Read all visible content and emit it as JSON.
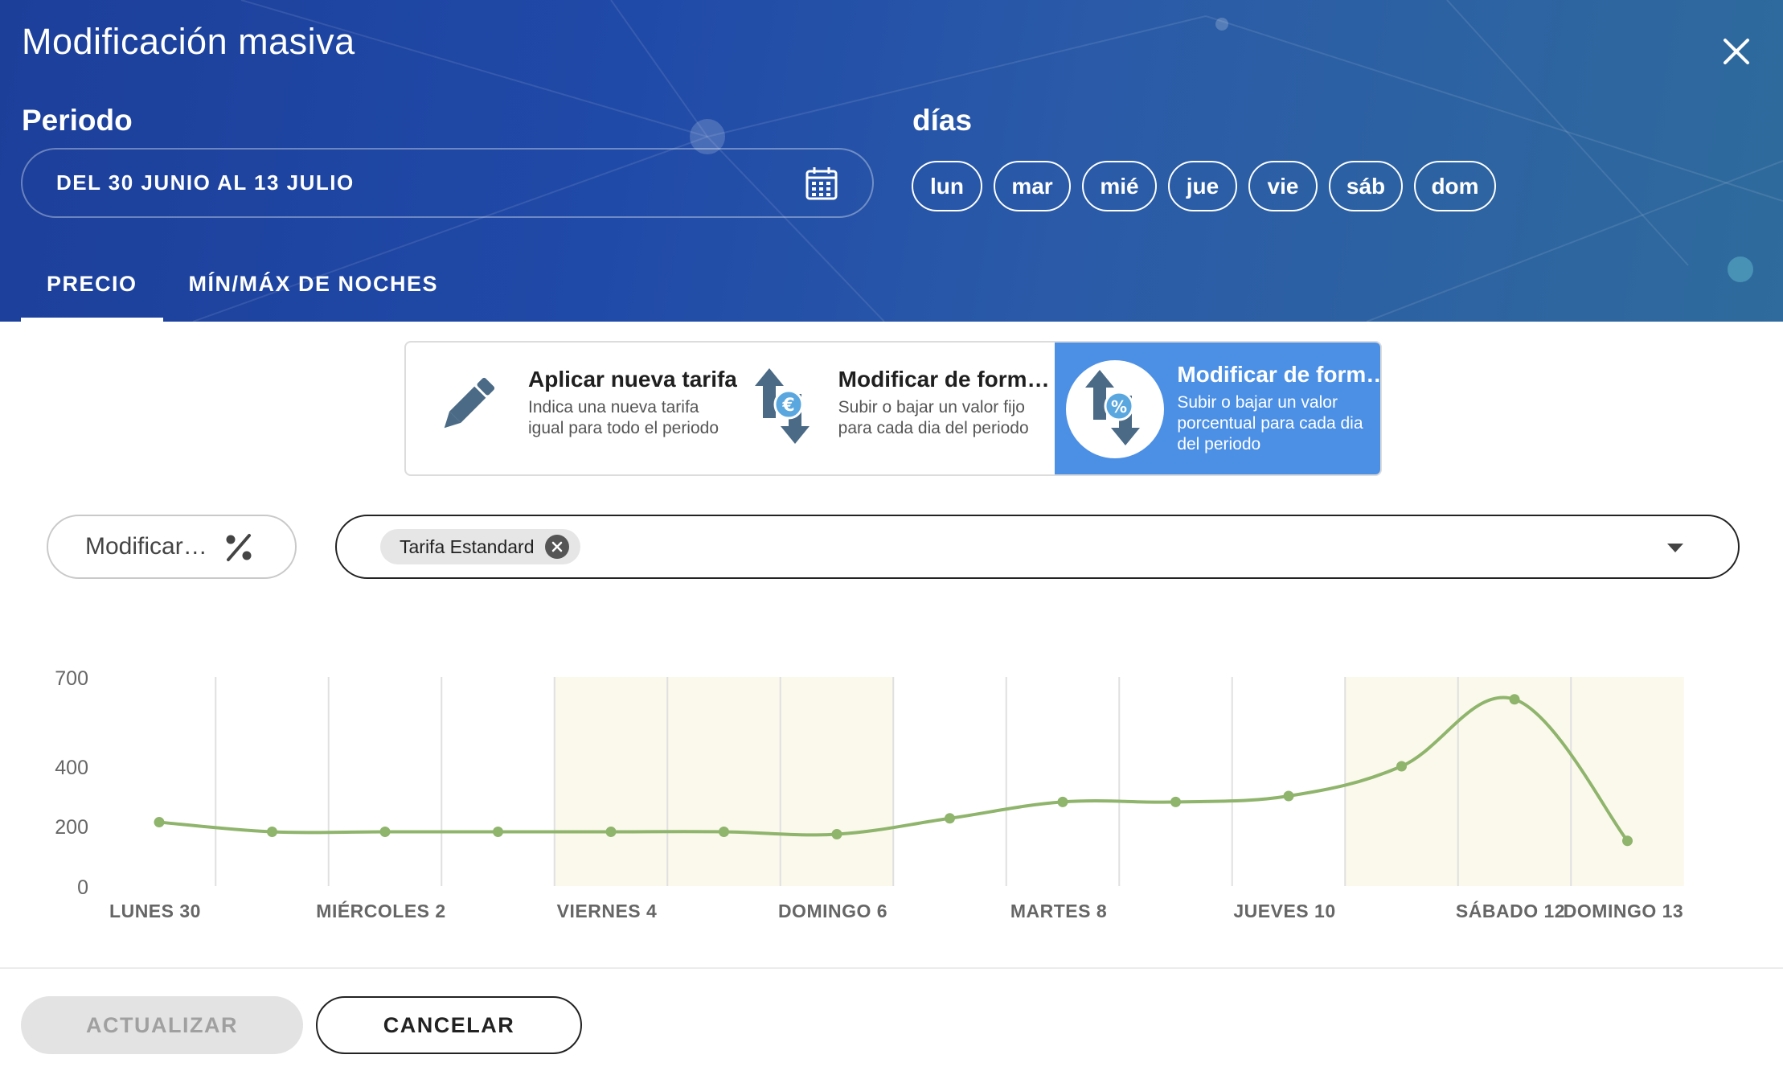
{
  "dialog": {
    "title": "Modificación masiva"
  },
  "period": {
    "label": "Periodo",
    "value": "DEL 30 JUNIO AL 13 JULIO"
  },
  "days": {
    "label": "días",
    "items": [
      "lun",
      "mar",
      "mié",
      "jue",
      "vie",
      "sáb",
      "dom"
    ]
  },
  "tabs": [
    {
      "label": "PRECIO",
      "active": true
    },
    {
      "label": "MÍN/MÁX DE NOCHES",
      "active": false
    }
  ],
  "modes": [
    {
      "title": "Aplicar nueva tarifa",
      "desc_lines": [
        "Indica una nueva tarifa",
        "igual para todo el periodo"
      ],
      "icon": "pencil-icon",
      "selected": false
    },
    {
      "title": "Modificar de form…",
      "desc_lines": [
        "Subir o bajar un valor fijo",
        "para cada dia del periodo"
      ],
      "icon": "arrows-euro-icon",
      "selected": false
    },
    {
      "title": "Modificar de form…",
      "desc_lines": [
        "Subir o bajar un valor",
        "porcentual para cada dia",
        "del periodo"
      ],
      "icon": "arrows-percent-icon",
      "selected": true
    }
  ],
  "modify_select": {
    "value": "Modificar…",
    "icon": "percent-icon"
  },
  "tarifa_select": {
    "chips": [
      "Tarifa Estandard"
    ]
  },
  "buttons": {
    "update": "ACTUALIZAR",
    "cancel": "CANCELAR"
  },
  "colors": {
    "header_bg": "#1f47a3",
    "selected_mode": "#4c90e6",
    "line": "#8fb46c",
    "weekend_band": "#fbf9ec"
  },
  "chart_data": {
    "type": "line",
    "y_ticks": [
      0,
      200,
      400,
      700
    ],
    "ylim": [
      0,
      700
    ],
    "x_tick_labels": [
      {
        "index": 0,
        "label": "LUNES 30"
      },
      {
        "index": 2,
        "label": "MIÉRCOLES 2"
      },
      {
        "index": 4,
        "label": "VIERNES 4"
      },
      {
        "index": 6,
        "label": "DOMINGO 6"
      },
      {
        "index": 8,
        "label": "MARTES 8"
      },
      {
        "index": 10,
        "label": "JUEVES 10"
      },
      {
        "index": 12,
        "label": "SÁBADO 12"
      },
      {
        "index": 13,
        "label": "DOMINGO 13"
      }
    ],
    "series": [
      {
        "values": [
          212,
          180,
          180,
          180,
          180,
          180,
          172,
          225,
          280,
          280,
          300,
          400,
          625,
          150
        ]
      }
    ],
    "highlighted_days": [
      [
        4,
        6
      ],
      [
        11,
        13
      ]
    ],
    "grid": true
  }
}
